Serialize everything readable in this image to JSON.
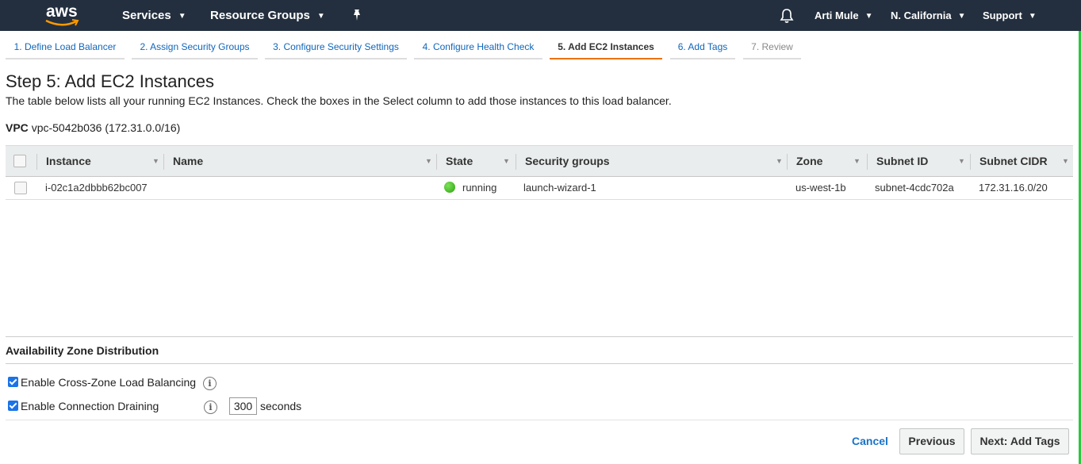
{
  "topnav": {
    "logo_text": "aws",
    "services": "Services",
    "resource_groups": "Resource Groups",
    "user": "Arti Mule",
    "region": "N. California",
    "support": "Support",
    "caret": "▼"
  },
  "steps": [
    {
      "label": "1. Define Load Balancer"
    },
    {
      "label": "2. Assign Security Groups"
    },
    {
      "label": "3. Configure Security Settings"
    },
    {
      "label": "4. Configure Health Check"
    },
    {
      "label": "5. Add EC2 Instances"
    },
    {
      "label": "6. Add Tags"
    },
    {
      "label": "7. Review"
    }
  ],
  "page": {
    "title": "Step 5: Add EC2 Instances",
    "description": "The table below lists all your running EC2 Instances. Check the boxes in the Select column to add those instances to this load balancer.",
    "vpc_label": "VPC",
    "vpc_value": "vpc-5042b036 (172.31.0.0/16)"
  },
  "table": {
    "columns": [
      "Instance",
      "Name",
      "State",
      "Security groups",
      "Zone",
      "Subnet ID",
      "Subnet CIDR"
    ],
    "sort_icon": "▼",
    "rows": [
      {
        "selected": false,
        "instance": "i-02c1a2dbbb62bc007",
        "name": "",
        "state": "running",
        "security_groups": "launch-wizard-1",
        "zone": "us-west-1b",
        "subnet_id": "subnet-4cdc702a",
        "subnet_cidr": "172.31.16.0/20"
      }
    ]
  },
  "availability": {
    "title": "Availability Zone Distribution",
    "cross_zone_label": "Enable Cross-Zone Load Balancing",
    "cross_zone_checked": true,
    "draining_label": "Enable Connection Draining",
    "draining_checked": true,
    "draining_value": "300",
    "seconds_label": "seconds",
    "info_glyph": "i"
  },
  "footer": {
    "cancel": "Cancel",
    "previous": "Previous",
    "next": "Next: Add Tags"
  },
  "colors": {
    "nav_bg": "#232f3e",
    "active_step_underline": "#ec7211",
    "link_blue": "#1166bb",
    "running_green": "#2ea10e"
  }
}
